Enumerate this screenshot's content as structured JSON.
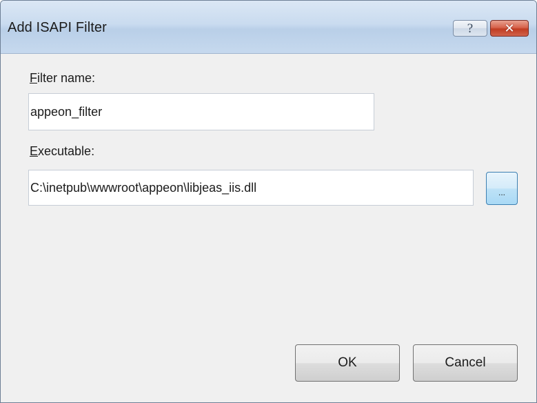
{
  "window": {
    "title": "Add ISAPI Filter",
    "help_glyph": "?",
    "close_glyph": "✕"
  },
  "filter_name": {
    "label_accel": "F",
    "label_rest": "ilter name:",
    "value": "appeon_filter"
  },
  "executable": {
    "label_accel": "E",
    "label_rest": "xecutable:",
    "value": "C:\\inetpub\\wwwroot\\appeon\\libjeas_iis.dll",
    "browse_label": "..."
  },
  "buttons": {
    "ok": "OK",
    "cancel": "Cancel"
  },
  "icons": {
    "help": "help-icon",
    "close": "close-icon"
  }
}
